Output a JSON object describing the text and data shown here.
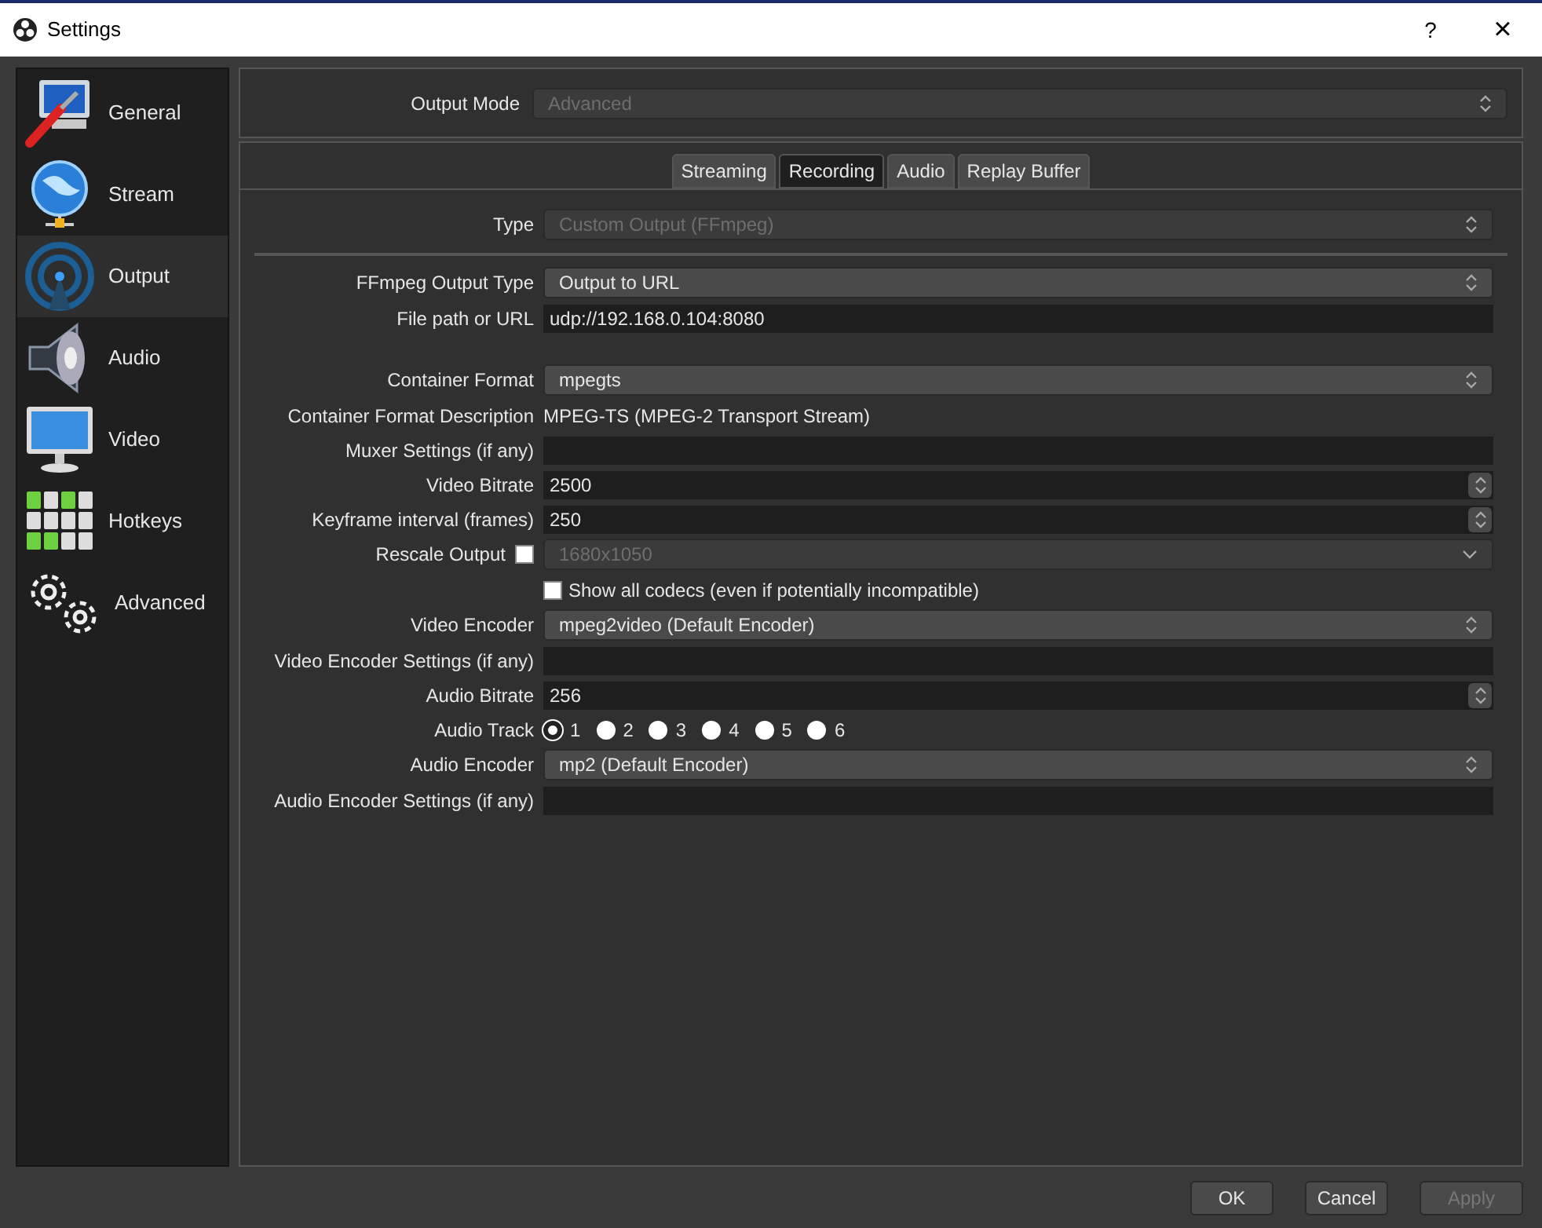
{
  "window": {
    "title": "Settings",
    "help": "?",
    "close": "×"
  },
  "sidebar": {
    "items": [
      {
        "label": "General",
        "kind": "general",
        "selected": false
      },
      {
        "label": "Stream",
        "kind": "stream",
        "selected": false
      },
      {
        "label": "Output",
        "kind": "output",
        "selected": true
      },
      {
        "label": "Audio",
        "kind": "audio",
        "selected": false
      },
      {
        "label": "Video",
        "kind": "video",
        "selected": false
      },
      {
        "label": "Hotkeys",
        "kind": "hotkeys",
        "selected": false
      },
      {
        "label": "Advanced",
        "kind": "advanced",
        "selected": false
      }
    ]
  },
  "output_mode": {
    "label": "Output Mode",
    "value": "Advanced",
    "disabled": true
  },
  "tabs": [
    {
      "label": "Streaming",
      "selected": false
    },
    {
      "label": "Recording",
      "selected": true
    },
    {
      "label": "Audio",
      "selected": false
    },
    {
      "label": "Replay Buffer",
      "selected": false
    }
  ],
  "type": {
    "label": "Type",
    "value": "Custom Output (FFmpeg)",
    "disabled": true
  },
  "fields": [
    {
      "kind": "select",
      "label": "FFmpeg Output Type",
      "value": "Output to URL",
      "disabled": false
    },
    {
      "kind": "input",
      "label": "File path or URL",
      "value": "udp://192.168.0.104:8080"
    },
    {
      "kind": "select",
      "label": "Container Format",
      "value": "mpegts",
      "disabled": false
    },
    {
      "kind": "text",
      "label": "Container Format Description",
      "value": "MPEG-TS (MPEG-2 Transport Stream)"
    },
    {
      "kind": "input",
      "label": "Muxer Settings (if any)"
    },
    {
      "kind": "spin",
      "label": "Video Bitrate",
      "value": "2500"
    },
    {
      "kind": "spin",
      "label": "Keyframe interval (frames)",
      "value": "250"
    },
    {
      "kind": "check_select",
      "label": "Rescale Output",
      "checked": false,
      "value": "1680x1050",
      "disabled": true
    },
    {
      "kind": "checkbox",
      "text": "Show all codecs (even if potentially incompatible)",
      "checked": false
    },
    {
      "kind": "select",
      "label": "Video Encoder",
      "value": "mpeg2video (Default Encoder)",
      "disabled": false
    },
    {
      "kind": "input",
      "label": "Video Encoder Settings (if any)"
    },
    {
      "kind": "spin",
      "label": "Audio Bitrate",
      "value": "256"
    },
    {
      "kind": "radio",
      "label": "Audio Track",
      "options": [
        {
          "label": "1",
          "selected": true
        },
        {
          "label": "2",
          "selected": false
        },
        {
          "label": "3",
          "selected": false
        },
        {
          "label": "4",
          "selected": false
        },
        {
          "label": "5",
          "selected": false
        },
        {
          "label": "6",
          "selected": false
        }
      ]
    },
    {
      "kind": "select",
      "label": "Audio Encoder",
      "value": "mp2 (Default Encoder)",
      "disabled": false
    },
    {
      "kind": "input",
      "label": "Audio Encoder Settings (if any)"
    }
  ],
  "buttons": [
    {
      "label": "OK",
      "disabled": false
    },
    {
      "label": "Cancel",
      "disabled": false
    },
    {
      "label": "Apply",
      "disabled": true
    }
  ]
}
